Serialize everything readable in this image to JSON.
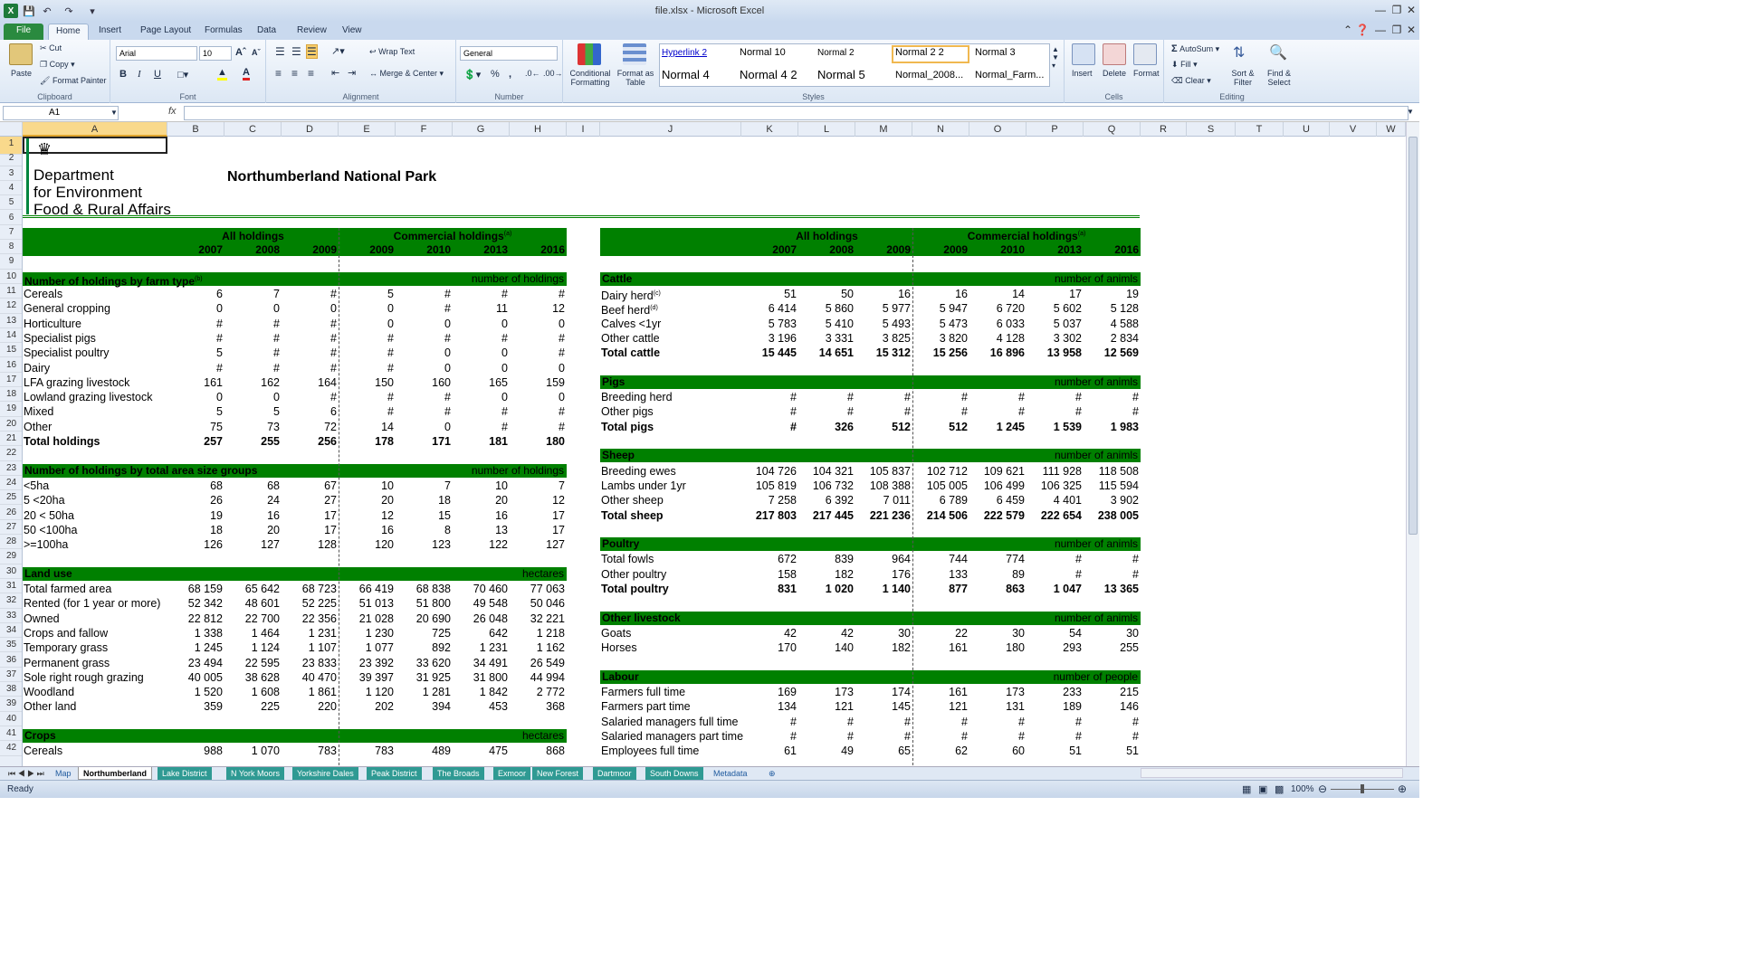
{
  "window": {
    "title": "file.xlsx - Microsoft Excel"
  },
  "ribbon_tabs": [
    "File",
    "Home",
    "Insert",
    "Page Layout",
    "Formulas",
    "Data",
    "Review",
    "View"
  ],
  "ribbon": {
    "clipboard": {
      "paste": "Paste",
      "cut": "Cut",
      "copy": "Copy",
      "format_painter": "Format Painter",
      "label": "Clipboard"
    },
    "font": {
      "name": "Arial",
      "size": "10",
      "bold": "B",
      "italic": "I",
      "underline": "U",
      "label": "Font"
    },
    "alignment": {
      "wrap": "Wrap Text",
      "merge": "Merge & Center",
      "label": "Alignment"
    },
    "number": {
      "format": "General",
      "percent": "%",
      "comma": ",",
      "label": "Number"
    },
    "styles": {
      "cond": "Conditional Formatting",
      "table": "Format as Table",
      "items": [
        "Hyperlink 2",
        "Normal 10",
        "Normal 2",
        "Normal 2 2",
        "Normal 3",
        "Normal 4",
        "Normal 4 2",
        "Normal 5",
        "Normal_2008...",
        "Normal_Farm..."
      ],
      "label": "Styles"
    },
    "cells": {
      "insert": "Insert",
      "delete": "Delete",
      "format": "Format",
      "label": "Cells"
    },
    "editing": {
      "autosum": "AutoSum",
      "fill": "Fill",
      "clear": "Clear",
      "sort": "Sort & Filter",
      "find": "Find & Select",
      "label": "Editing"
    }
  },
  "formula_bar": {
    "name_box": "A1",
    "fx": "fx",
    "formula": ""
  },
  "columns": [
    "A",
    "B",
    "C",
    "D",
    "E",
    "F",
    "G",
    "H",
    "I",
    "J",
    "K",
    "L",
    "M",
    "N",
    "O",
    "P",
    "Q",
    "R",
    "S",
    "T",
    "U",
    "V",
    "W"
  ],
  "rows": [
    "1",
    "2",
    "3",
    "4",
    "5",
    "6",
    "7",
    "8",
    "9",
    "10",
    "11",
    "12",
    "13",
    "14",
    "15",
    "16",
    "17",
    "18",
    "19",
    "20",
    "21",
    "22",
    "23",
    "24",
    "25",
    "26",
    "27",
    "28",
    "29",
    "30",
    "31",
    "32",
    "33",
    "34",
    "35",
    "36",
    "37",
    "38",
    "39",
    "40",
    "41",
    "42"
  ],
  "logo": {
    "line1": "Department",
    "line2": "for Environment",
    "line3": "Food & Rural Affairs"
  },
  "sheet_title": "Northumberland National Park",
  "header": {
    "all": "All holdings",
    "comm": "Commercial holdings",
    "sup": "(a)",
    "years_all": [
      "2007",
      "2008",
      "2009"
    ],
    "years_comm": [
      "2009",
      "2010",
      "2013",
      "2016"
    ]
  },
  "left_sections": [
    {
      "title": "Number of holdings by farm type",
      "sup": "(b)",
      "unit": "number of holdings",
      "rows": [
        {
          "label": "Cereals",
          "v": [
            "6",
            "7",
            "#",
            "5",
            "#",
            "#",
            "#"
          ]
        },
        {
          "label": "General cropping",
          "v": [
            "0",
            "0",
            "0",
            "0",
            "#",
            "11",
            "12"
          ]
        },
        {
          "label": "Horticulture",
          "v": [
            "#",
            "#",
            "#",
            "0",
            "0",
            "0",
            "0"
          ]
        },
        {
          "label": "Specialist pigs",
          "v": [
            "#",
            "#",
            "#",
            "#",
            "#",
            "#",
            "#"
          ]
        },
        {
          "label": "Specialist poultry",
          "v": [
            "5",
            "#",
            "#",
            "#",
            "0",
            "0",
            "#"
          ]
        },
        {
          "label": "Dairy",
          "v": [
            "#",
            "#",
            "#",
            "#",
            "0",
            "0",
            "0"
          ]
        },
        {
          "label": "LFA grazing livestock",
          "v": [
            "161",
            "162",
            "164",
            "150",
            "160",
            "165",
            "159"
          ]
        },
        {
          "label": "Lowland grazing livestock",
          "v": [
            "0",
            "0",
            "#",
            "#",
            "#",
            "0",
            "0"
          ]
        },
        {
          "label": "Mixed",
          "v": [
            "5",
            "5",
            "6",
            "#",
            "#",
            "#",
            "#"
          ]
        },
        {
          "label": "Other",
          "v": [
            "75",
            "73",
            "72",
            "14",
            "0",
            "#",
            "#"
          ]
        },
        {
          "label": "Total holdings",
          "bold": true,
          "v": [
            "257",
            "255",
            "256",
            "178",
            "171",
            "181",
            "180"
          ]
        }
      ]
    },
    {
      "title": "Number of holdings by total area size groups",
      "unit": "number of holdings",
      "rows": [
        {
          "label": "<5ha",
          "v": [
            "68",
            "68",
            "67",
            "10",
            "7",
            "10",
            "7"
          ]
        },
        {
          "label": "5 <20ha",
          "v": [
            "26",
            "24",
            "27",
            "20",
            "18",
            "20",
            "12"
          ]
        },
        {
          "label": "20 < 50ha",
          "v": [
            "19",
            "16",
            "17",
            "12",
            "15",
            "16",
            "17"
          ]
        },
        {
          "label": "50 <100ha",
          "v": [
            "18",
            "20",
            "17",
            "16",
            "8",
            "13",
            "17"
          ]
        },
        {
          "label": ">=100ha",
          "v": [
            "126",
            "127",
            "128",
            "120",
            "123",
            "122",
            "127"
          ]
        }
      ]
    },
    {
      "title": "Land use",
      "unit": "hectares",
      "rows": [
        {
          "label": "Total farmed area",
          "v": [
            "68 159",
            "65 642",
            "68 723",
            "66 419",
            "68 838",
            "70 460",
            "77 063"
          ]
        },
        {
          "label": "Rented (for 1 year or more)",
          "v": [
            "52 342",
            "48 601",
            "52 225",
            "51 013",
            "51 800",
            "49 548",
            "50 046"
          ]
        },
        {
          "label": "Owned",
          "v": [
            "22 812",
            "22 700",
            "22 356",
            "21 028",
            "20 690",
            "26 048",
            "32 221"
          ]
        },
        {
          "label": "Crops and fallow",
          "v": [
            "1 338",
            "1 464",
            "1 231",
            "1 230",
            "725",
            "642",
            "1 218"
          ]
        },
        {
          "label": "Temporary grass",
          "v": [
            "1 245",
            "1 124",
            "1 107",
            "1 077",
            "892",
            "1 231",
            "1 162"
          ]
        },
        {
          "label": "Permanent grass",
          "v": [
            "23 494",
            "22 595",
            "23 833",
            "23 392",
            "33 620",
            "34 491",
            "26 549"
          ]
        },
        {
          "label": "Sole right rough grazing",
          "v": [
            "40 005",
            "38 628",
            "40 470",
            "39 397",
            "31 925",
            "31 800",
            "44 994"
          ]
        },
        {
          "label": "Woodland",
          "v": [
            "1 520",
            "1 608",
            "1 861",
            "1 120",
            "1 281",
            "1 842",
            "2 772"
          ]
        },
        {
          "label": "Other land",
          "v": [
            "359",
            "225",
            "220",
            "202",
            "394",
            "453",
            "368"
          ]
        }
      ]
    },
    {
      "title": "Crops",
      "unit": "hectares",
      "rows": [
        {
          "label": "Cereals",
          "v": [
            "988",
            "1 070",
            "783",
            "783",
            "489",
            "475",
            "868"
          ]
        }
      ]
    }
  ],
  "right_sections": [
    {
      "title": "Cattle",
      "unit": "number of animls",
      "rows": [
        {
          "label": "Dairy herd",
          "sup": "(c)",
          "v": [
            "51",
            "50",
            "16",
            "16",
            "14",
            "17",
            "19"
          ]
        },
        {
          "label": "Beef herd",
          "sup": "(d)",
          "v": [
            "6 414",
            "5 860",
            "5 977",
            "5 947",
            "6 720",
            "5 602",
            "5 128"
          ]
        },
        {
          "label": "Calves <1yr",
          "v": [
            "5 783",
            "5 410",
            "5 493",
            "5 473",
            "6 033",
            "5 037",
            "4 588"
          ]
        },
        {
          "label": "Other cattle",
          "v": [
            "3 196",
            "3 331",
            "3 825",
            "3 820",
            "4 128",
            "3 302",
            "2 834"
          ]
        },
        {
          "label": "Total cattle",
          "bold": true,
          "v": [
            "15 445",
            "14 651",
            "15 312",
            "15 256",
            "16 896",
            "13 958",
            "12 569"
          ]
        }
      ]
    },
    {
      "title": "Pigs",
      "unit": "number of animls",
      "rows": [
        {
          "label": "Breeding herd",
          "v": [
            "#",
            "#",
            "#",
            "#",
            "#",
            "#",
            "#"
          ]
        },
        {
          "label": "Other pigs",
          "v": [
            "#",
            "#",
            "#",
            "#",
            "#",
            "#",
            "#"
          ]
        },
        {
          "label": "Total pigs",
          "bold": true,
          "v": [
            "#",
            "326",
            "512",
            "512",
            "1 245",
            "1 539",
            "1 983"
          ]
        }
      ]
    },
    {
      "title": "Sheep",
      "unit": "number of animls",
      "rows": [
        {
          "label": "Breeding ewes",
          "v": [
            "104 726",
            "104 321",
            "105 837",
            "102 712",
            "109 621",
            "111 928",
            "118 508"
          ]
        },
        {
          "label": "Lambs under 1yr",
          "v": [
            "105 819",
            "106 732",
            "108 388",
            "105 005",
            "106 499",
            "106 325",
            "115 594"
          ]
        },
        {
          "label": "Other sheep",
          "v": [
            "7 258",
            "6 392",
            "7 011",
            "6 789",
            "6 459",
            "4 401",
            "3 902"
          ]
        },
        {
          "label": "Total sheep",
          "bold": true,
          "v": [
            "217 803",
            "217 445",
            "221 236",
            "214 506",
            "222 579",
            "222 654",
            "238 005"
          ]
        }
      ]
    },
    {
      "title": "Poultry",
      "unit": "number of animls",
      "rows": [
        {
          "label": "Total fowls",
          "v": [
            "672",
            "839",
            "964",
            "744",
            "774",
            "#",
            "#"
          ]
        },
        {
          "label": "Other poultry",
          "v": [
            "158",
            "182",
            "176",
            "133",
            "89",
            "#",
            "#"
          ]
        },
        {
          "label": "Total poultry",
          "bold": true,
          "v": [
            "831",
            "1 020",
            "1 140",
            "877",
            "863",
            "1 047",
            "13 365"
          ]
        }
      ]
    },
    {
      "title": "Other livestock",
      "unit": "number of animls",
      "rows": [
        {
          "label": "Goats",
          "v": [
            "42",
            "42",
            "30",
            "22",
            "30",
            "54",
            "30"
          ]
        },
        {
          "label": "Horses",
          "v": [
            "170",
            "140",
            "182",
            "161",
            "180",
            "293",
            "255"
          ]
        }
      ]
    },
    {
      "title": "Labour",
      "unit": "number of people",
      "rows": [
        {
          "label": "Farmers full time",
          "v": [
            "169",
            "173",
            "174",
            "161",
            "173",
            "233",
            "215"
          ]
        },
        {
          "label": "Farmers part time",
          "v": [
            "134",
            "121",
            "145",
            "121",
            "131",
            "189",
            "146"
          ]
        },
        {
          "label": "Salaried managers full time",
          "v": [
            "#",
            "#",
            "#",
            "#",
            "#",
            "#",
            "#"
          ]
        },
        {
          "label": "Salaried managers part time",
          "v": [
            "#",
            "#",
            "#",
            "#",
            "#",
            "#",
            "#"
          ]
        },
        {
          "label": "Employees full time",
          "v": [
            "61",
            "49",
            "65",
            "62",
            "60",
            "51",
            "51"
          ]
        }
      ]
    }
  ],
  "sheet_tabs": [
    "Map",
    "Northumberland",
    "Lake District",
    "N York Moors",
    "Yorkshire Dales",
    "Peak District",
    "The Broads",
    "Exmoor",
    "New Forest",
    "Dartmoor",
    "South Downs",
    "Metadata"
  ],
  "active_tab": "Northumberland",
  "status": {
    "ready": "Ready",
    "zoom": "100%"
  },
  "colors": {
    "band": "#008000",
    "selection": "#f9d98c"
  }
}
